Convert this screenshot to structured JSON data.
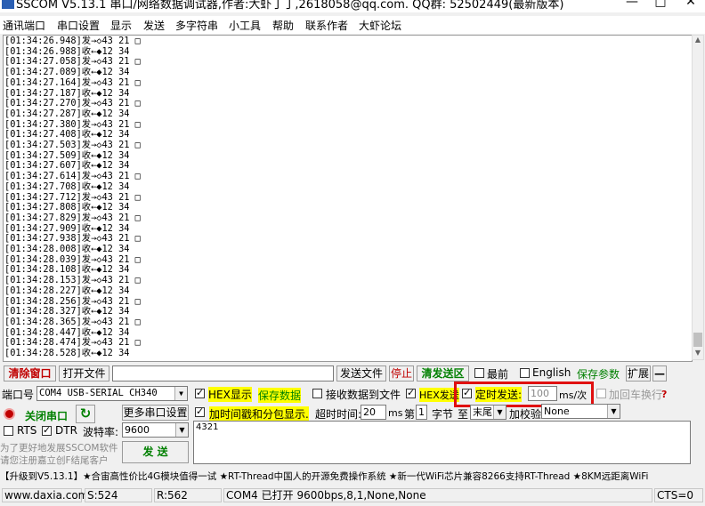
{
  "window": {
    "title": "SSCOM V5.13.1 串口/网络数据调试器,作者:大虾丁丁,2618058@qq.com. QQ群: 52502449(最新版本)",
    "minimize": "—",
    "maximize": "□",
    "close": "✕"
  },
  "menu": [
    "通讯端口",
    "串口设置",
    "显示",
    "发送",
    "多字符串",
    "小工具",
    "帮助",
    "联系作者",
    "大虾论坛"
  ],
  "receive": {
    "lines": [
      "[01:34:26.948]发→◇43 21 □",
      "[01:34:26.988]收←◆12 34",
      "[01:34:27.058]发→◇43 21 □",
      "[01:34:27.089]收←◆12 34",
      "[01:34:27.164]发→◇43 21 □",
      "[01:34:27.187]收←◆12 34",
      "[01:34:27.270]发→◇43 21 □",
      "[01:34:27.287]收←◆12 34",
      "[01:34:27.380]发→◇43 21 □",
      "[01:34:27.408]收←◆12 34",
      "[01:34:27.503]发→◇43 21 □",
      "[01:34:27.509]收←◆12 34",
      "[01:34:27.607]收←◆12 34",
      "[01:34:27.614]发→◇43 21 □",
      "[01:34:27.708]收←◆12 34",
      "[01:34:27.712]发→◇43 21 □",
      "[01:34:27.808]收←◆12 34",
      "[01:34:27.829]发→◇43 21 □",
      "[01:34:27.909]收←◆12 34",
      "[01:34:27.938]发→◇43 21 □",
      "[01:34:28.008]收←◆12 34",
      "[01:34:28.039]发→◇43 21 □",
      "[01:34:28.108]收←◆12 34",
      "[01:34:28.153]发→◇43 21 □",
      "[01:34:28.227]收←◆12 34",
      "[01:34:28.256]发→◇43 21 □",
      "[01:34:28.327]收←◆12 34",
      "[01:34:28.365]发→◇43 21 □",
      "[01:34:28.447]收←◆12 34",
      "[01:34:28.474]发→◇43 21 □",
      "[01:34:28.528]收←◆12 34"
    ]
  },
  "toolbar": {
    "clear_window": "清除窗口",
    "open_file": "打开文件",
    "file_path": "",
    "send_file": "发送文件",
    "stop": "停止",
    "clear_send_area": "清发送区",
    "topmost": "最前",
    "english": "English",
    "save_params": "保存参数",
    "expand": "扩展",
    "collapse": "—"
  },
  "port": {
    "label": "端口号",
    "value": "COM4 USB-SERIAL CH340",
    "close_port": "关闭串口",
    "more_settings": "更多串口设置",
    "rts": "RTS",
    "dtr": "DTR",
    "baud_label": "波特率:",
    "baud_value": "9600",
    "promo_line1": "为了更好地发展SSCOM软件",
    "promo_line2": "请您注册嘉立创F结尾客户",
    "send": "发 送"
  },
  "options": {
    "hex_display": "HEX显示",
    "save_data": "保存数据",
    "recv_to_file": "接收数据到文件",
    "hex_send": "HEX发送",
    "timed_send": "定时发送:",
    "interval": "100",
    "interval_unit": "ms/次",
    "add_newline": "加回车换行",
    "timestamp": "加时间戳和分包显示.",
    "timeout_label": "超时时间:",
    "timeout_value": "20",
    "timeout_unit": "ms",
    "frame_no": "第",
    "frame_value": "1",
    "byte_label": "字节",
    "to_label": "至",
    "end_value": "末尾",
    "checksum_label": "加校验",
    "checksum_value": "None"
  },
  "send_input": {
    "value": "4321"
  },
  "ticker": "【升级到V5.13.1】★合宙高性价比4G模块值得一试 ★RT-Thread中国人的开源免费操作系统 ★新一代WiFi芯片兼容8266支持RT-Thread ★8KM远距离WiFi",
  "status": {
    "website": "www.daxia.com",
    "sent": "S:524",
    "received": "R:562",
    "port_status": "COM4 已打开  9600bps,8,1,None,None",
    "cts": "CTS=0"
  },
  "colors": {
    "highlight_box": "#e01010",
    "highlight_text": "#ffff00",
    "green_text": "#008000",
    "red_text": "#c00000"
  }
}
